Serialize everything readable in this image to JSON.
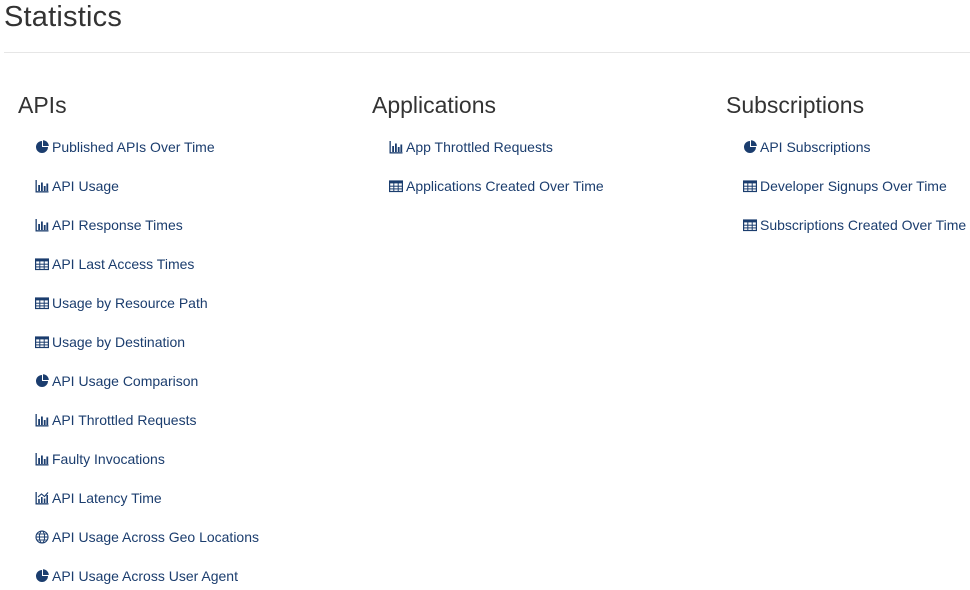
{
  "page": {
    "title": "Statistics"
  },
  "columns": [
    {
      "title": "APIs",
      "items": [
        {
          "label": "Published APIs Over Time",
          "icon": "pie-chart-icon"
        },
        {
          "label": "API Usage",
          "icon": "bar-chart-icon"
        },
        {
          "label": "API Response Times",
          "icon": "bar-chart-icon"
        },
        {
          "label": "API Last Access Times",
          "icon": "table-icon"
        },
        {
          "label": "Usage by Resource Path",
          "icon": "table-icon"
        },
        {
          "label": "Usage by Destination",
          "icon": "table-icon"
        },
        {
          "label": "API Usage Comparison",
          "icon": "pie-chart-icon"
        },
        {
          "label": "API Throttled Requests",
          "icon": "bar-chart-icon"
        },
        {
          "label": "Faulty Invocations",
          "icon": "bar-chart-icon"
        },
        {
          "label": "API Latency Time",
          "icon": "line-bar-chart-icon"
        },
        {
          "label": "API Usage Across Geo Locations",
          "icon": "globe-icon"
        },
        {
          "label": "API Usage Across User Agent",
          "icon": "pie-chart-icon"
        }
      ]
    },
    {
      "title": "Applications",
      "items": [
        {
          "label": "App Throttled Requests",
          "icon": "bar-chart-icon"
        },
        {
          "label": "Applications Created Over Time",
          "icon": "table-icon"
        }
      ]
    },
    {
      "title": "Subscriptions",
      "items": [
        {
          "label": "API Subscriptions",
          "icon": "pie-chart-icon"
        },
        {
          "label": "Developer Signups Over Time",
          "icon": "table-icon"
        },
        {
          "label": "Subscriptions Created Over Time",
          "icon": "table-icon"
        }
      ]
    }
  ],
  "colors": {
    "link": "#1b3d6e",
    "text": "#333333",
    "divider": "#e6e6e6"
  }
}
